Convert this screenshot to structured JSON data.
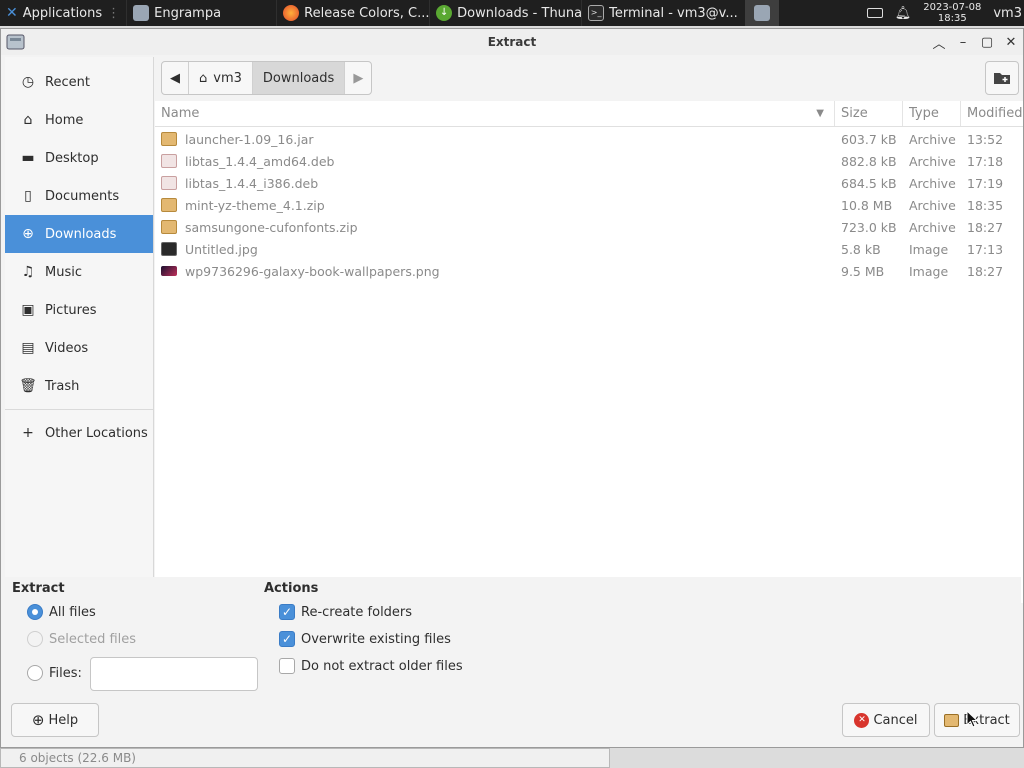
{
  "taskbar": {
    "apps_label": "Applications",
    "windows": [
      {
        "label": "Engrampa",
        "icon": "engrampa-icon"
      },
      {
        "label": "Release Colors, C...",
        "icon": "firefox-icon"
      },
      {
        "label": "Downloads - Thunar",
        "icon": "download-icon"
      },
      {
        "label": "Terminal - vm3@v...",
        "icon": "terminal-icon"
      }
    ],
    "clock_date": "2023-07-08",
    "clock_time": "18:35",
    "user": "vm3"
  },
  "window": {
    "title": "Extract"
  },
  "sidebar": {
    "items": [
      {
        "label": "Recent",
        "icon": "clock-icon"
      },
      {
        "label": "Home",
        "icon": "home-icon"
      },
      {
        "label": "Desktop",
        "icon": "folder-icon"
      },
      {
        "label": "Documents",
        "icon": "document-icon"
      },
      {
        "label": "Downloads",
        "icon": "download-icon"
      },
      {
        "label": "Music",
        "icon": "music-icon"
      },
      {
        "label": "Pictures",
        "icon": "picture-icon"
      },
      {
        "label": "Videos",
        "icon": "video-icon"
      },
      {
        "label": "Trash",
        "icon": "trash-icon"
      }
    ],
    "other_locations": "Other Locations",
    "active": "Downloads"
  },
  "pathbar": {
    "crumbs": [
      "vm3",
      "Downloads"
    ]
  },
  "table": {
    "headers": {
      "name": "Name",
      "size": "Size",
      "type": "Type",
      "modified": "Modified"
    },
    "rows": [
      {
        "name": "launcher-1.09_16.jar",
        "size": "603.7 kB",
        "type": "Archive",
        "modified": "13:52",
        "icon": "archive-icon"
      },
      {
        "name": "libtas_1.4.4_amd64.deb",
        "size": "882.8 kB",
        "type": "Archive",
        "modified": "17:18",
        "icon": "deb-package-icon"
      },
      {
        "name": "libtas_1.4.4_i386.deb",
        "size": "684.5 kB",
        "type": "Archive",
        "modified": "17:19",
        "icon": "deb-package-icon"
      },
      {
        "name": "mint-yz-theme_4.1.zip",
        "size": "10.8 MB",
        "type": "Archive",
        "modified": "18:35",
        "icon": "archive-icon"
      },
      {
        "name": "samsungone-cufonfonts.zip",
        "size": "723.0 kB",
        "type": "Archive",
        "modified": "18:27",
        "icon": "archive-icon"
      },
      {
        "name": "Untitled.jpg",
        "size": "5.8 kB",
        "type": "Image",
        "modified": "17:13",
        "icon": "image-icon"
      },
      {
        "name": "wp9736296-galaxy-book-wallpapers.png",
        "size": "9.5 MB",
        "type": "Image",
        "modified": "18:27",
        "icon": "image-icon"
      }
    ]
  },
  "extract": {
    "title": "Extract",
    "all_files": "All files",
    "selected_files": "Selected files",
    "files": "Files:",
    "files_value": ""
  },
  "actions": {
    "title": "Actions",
    "recreate": "Re-create folders",
    "overwrite": "Overwrite existing files",
    "older": "Do not extract older files"
  },
  "buttons": {
    "help": "Help",
    "cancel": "Cancel",
    "extract": "Extract"
  },
  "status": "6 objects (22.6 MB)",
  "colors": {
    "accent": "#4a90d9",
    "taskbar": "#1f1f1f"
  }
}
